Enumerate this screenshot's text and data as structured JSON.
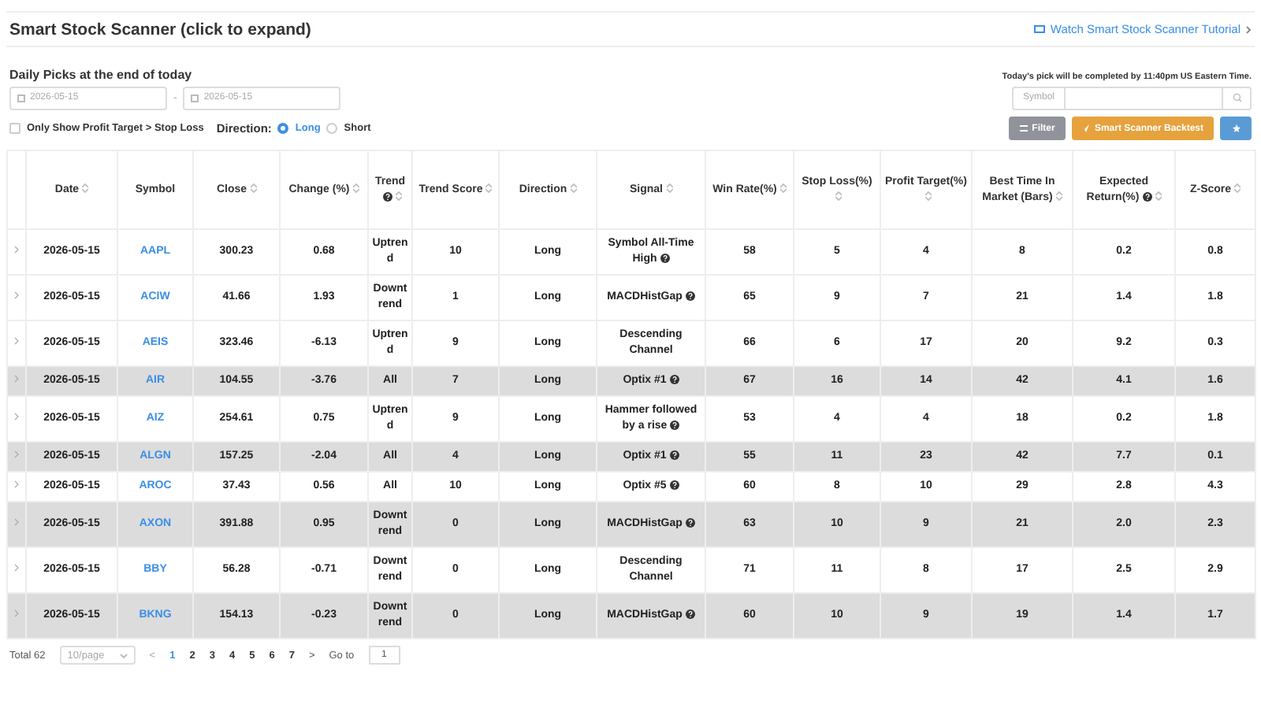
{
  "title": "Smart Stock Scanner (click to expand)",
  "tutorial_link": "Watch Smart Stock Scanner Tutorial",
  "subtitle": "Daily Picks at the end of today",
  "notice": "Today's pick will be completed by 11:40pm US Eastern Time.",
  "date_range": {
    "start": "2026-05-15",
    "separator": "-",
    "end": "2026-05-15"
  },
  "symbol_search": {
    "label": "Symbol"
  },
  "profit_filter": {
    "label": "Only Show Profit Target > Stop Loss",
    "checked": false
  },
  "direction": {
    "label": "Direction:",
    "options": [
      {
        "label": "Long",
        "selected": true
      },
      {
        "label": "Short",
        "selected": false
      }
    ]
  },
  "buttons": [
    {
      "kind": "filter",
      "label": "Filter"
    },
    {
      "kind": "backtest",
      "label": "Smart Scanner Backtest"
    },
    {
      "kind": "star"
    }
  ],
  "table": {
    "columns": [
      {
        "label": "Date",
        "sortable": true,
        "help": false
      },
      {
        "label": "Symbol",
        "sortable": false,
        "help": false
      },
      {
        "label": "Close",
        "sortable": true,
        "help": false
      },
      {
        "label": "Change (%)",
        "sortable": true,
        "help": false
      },
      {
        "label": "Trend",
        "sortable": true,
        "help": true
      },
      {
        "label": "Trend Score",
        "sortable": true,
        "help": false
      },
      {
        "label": "Direction",
        "sortable": true,
        "help": false
      },
      {
        "label": "Signal",
        "sortable": true,
        "help": false
      },
      {
        "label": "Win Rate(%)",
        "sortable": true,
        "help": false
      },
      {
        "label": "Stop Loss(%)",
        "sortable": true,
        "help": false
      },
      {
        "label": "Profit Target(%)",
        "sortable": true,
        "help": false
      },
      {
        "label": "Best Time In Market (Bars)",
        "sortable": true,
        "help": false
      },
      {
        "label": "Expected Return(%)",
        "sortable": true,
        "help": true
      },
      {
        "label": "Z-Score",
        "sortable": true,
        "help": false
      }
    ],
    "rows": [
      {
        "highlighted": false,
        "cells": [
          "2026-05-15",
          "AAPL",
          "300.23",
          "0.68",
          "Uptrend",
          "10",
          "Long",
          "Symbol All-Time High",
          "58",
          "5",
          "4",
          "8",
          "0.2",
          "0.8"
        ],
        "signal_help": true
      },
      {
        "highlighted": false,
        "cells": [
          "2026-05-15",
          "ACIW",
          "41.66",
          "1.93",
          "Downtrend",
          "1",
          "Long",
          "MACDHistGap",
          "65",
          "9",
          "7",
          "21",
          "1.4",
          "1.8"
        ],
        "signal_help": true
      },
      {
        "highlighted": false,
        "cells": [
          "2026-05-15",
          "AEIS",
          "323.46",
          "-6.13",
          "Uptrend",
          "9",
          "Long",
          "Descending Channel",
          "66",
          "6",
          "17",
          "20",
          "9.2",
          "0.3"
        ],
        "signal_help": false
      },
      {
        "highlighted": true,
        "cells": [
          "2026-05-15",
          "AIR",
          "104.55",
          "-3.76",
          "All",
          "7",
          "Long",
          "Optix #1",
          "67",
          "16",
          "14",
          "42",
          "4.1",
          "1.6"
        ],
        "signal_help": true
      },
      {
        "highlighted": false,
        "cells": [
          "2026-05-15",
          "AIZ",
          "254.61",
          "0.75",
          "Uptrend",
          "9",
          "Long",
          "Hammer followed by a rise",
          "53",
          "4",
          "4",
          "18",
          "0.2",
          "1.8"
        ],
        "signal_help": true
      },
      {
        "highlighted": true,
        "cells": [
          "2026-05-15",
          "ALGN",
          "157.25",
          "-2.04",
          "All",
          "4",
          "Long",
          "Optix #1",
          "55",
          "11",
          "23",
          "42",
          "7.7",
          "0.1"
        ],
        "signal_help": true
      },
      {
        "highlighted": false,
        "cells": [
          "2026-05-15",
          "AROC",
          "37.43",
          "0.56",
          "All",
          "10",
          "Long",
          "Optix #5",
          "60",
          "8",
          "10",
          "29",
          "2.8",
          "4.3"
        ],
        "signal_help": true
      },
      {
        "highlighted": true,
        "cells": [
          "2026-05-15",
          "AXON",
          "391.88",
          "0.95",
          "Downtrend",
          "0",
          "Long",
          "MACDHistGap",
          "63",
          "10",
          "9",
          "21",
          "2.0",
          "2.3"
        ],
        "signal_help": true
      },
      {
        "highlighted": false,
        "cells": [
          "2026-05-15",
          "BBY",
          "56.28",
          "-0.71",
          "Downtrend",
          "0",
          "Long",
          "Descending Channel",
          "71",
          "11",
          "8",
          "17",
          "2.5",
          "2.9"
        ],
        "signal_help": false
      },
      {
        "highlighted": true,
        "cells": [
          "2026-05-15",
          "BKNG",
          "154.13",
          "-0.23",
          "Downtrend",
          "0",
          "Long",
          "MACDHistGap",
          "60",
          "10",
          "9",
          "19",
          "1.4",
          "1.7"
        ],
        "signal_help": true
      }
    ]
  },
  "pagination": {
    "total": "Total 62",
    "page_size": "10/page",
    "prev": "<",
    "pages": [
      {
        "label": "1",
        "selected": true
      },
      {
        "label": "2",
        "selected": false
      },
      {
        "label": "3",
        "selected": false
      },
      {
        "label": "4",
        "selected": false
      },
      {
        "label": "5",
        "selected": false
      },
      {
        "label": "6",
        "selected": false
      },
      {
        "label": "7",
        "selected": false
      }
    ],
    "next": ">",
    "goto_label": "Go to",
    "goto_value": "1"
  }
}
